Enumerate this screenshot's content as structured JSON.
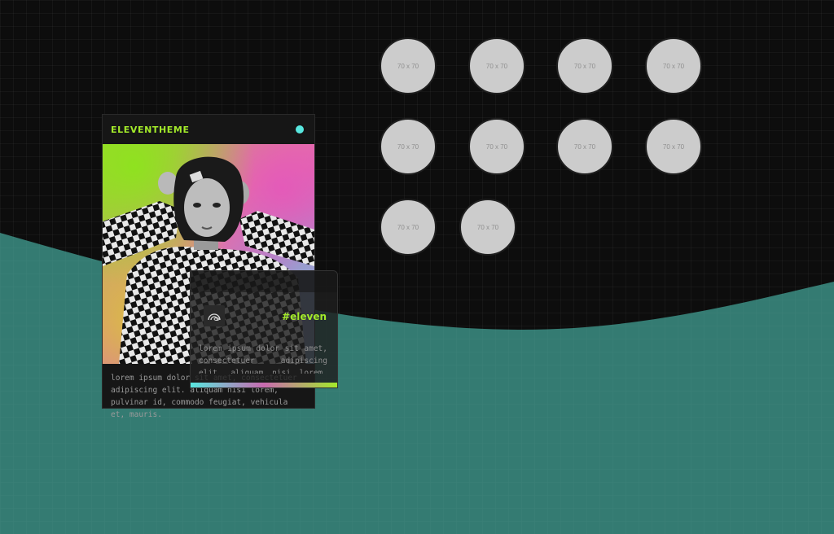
{
  "card": {
    "title": "ELEVENTHEME",
    "description": "lorem ipsum dolor sit amet, consectetuer adipiscing elit. aliquam nisi lorem, pulvinar id, commodo feugiat, vehicula et, mauris.",
    "accent_color": "#a3ea2a",
    "dot_color": "#58e7df"
  },
  "overlay": {
    "icon": "rainbow-icon",
    "hashtag": "#eleven",
    "text": "lorem ipsum dolor sit amet, consectetuer adipiscing elit. aliquam nisi lorem, pulvinar id"
  },
  "avatars": [
    {
      "label": "70 x 70"
    },
    {
      "label": "70 x 70"
    },
    {
      "label": "70 x 70"
    },
    {
      "label": "70 x 70"
    },
    {
      "label": "70 x 70"
    },
    {
      "label": "70 x 70"
    },
    {
      "label": "70 x 70"
    },
    {
      "label": "70 x 70"
    },
    {
      "label": "70 x 70"
    },
    {
      "label": "70 x 70"
    }
  ],
  "colors": {
    "background": "#0d0d0d",
    "wave": "#347b72"
  }
}
